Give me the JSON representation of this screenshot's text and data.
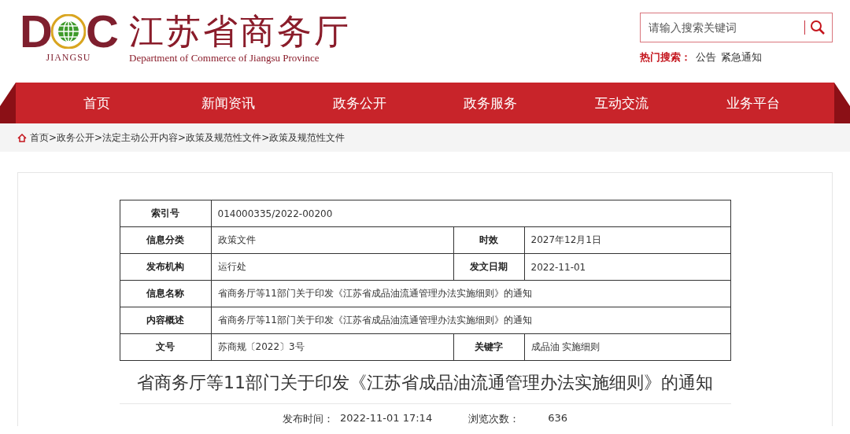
{
  "logo": {
    "letters": [
      "D",
      "C"
    ],
    "region": "JIANGSU",
    "name_cn": "江苏省商务厅",
    "name_en": "Department of Commerce of Jiangsu Province"
  },
  "search": {
    "placeholder": "请输入搜索关键词"
  },
  "hot_search": {
    "label": "热门搜索：",
    "items": [
      "公告",
      "紧急通知"
    ]
  },
  "nav": [
    "首页",
    "新闻资讯",
    "政务公开",
    "政务服务",
    "互动交流",
    "业务平台"
  ],
  "breadcrumb": "首页>政务公开>法定主动公开内容>政策及规范性文件>政策及规范性文件",
  "info_table": {
    "rows": [
      [
        {
          "label": "索引号",
          "value": "014000335/2022-00200"
        }
      ],
      [
        {
          "label": "信息分类",
          "value": "政策文件"
        },
        {
          "label": "时效",
          "value": "2027年12月1日"
        }
      ],
      [
        {
          "label": "发布机构",
          "value": "运行处"
        },
        {
          "label": "发文日期",
          "value": "2022-11-01"
        }
      ],
      [
        {
          "label": "信息名称",
          "value": "省商务厅等11部门关于印发《江苏省成品油流通管理办法实施细则》的通知"
        }
      ],
      [
        {
          "label": "内容概述",
          "value": "省商务厅等11部门关于印发《江苏省成品油流通管理办法实施细则》的通知"
        }
      ],
      [
        {
          "label": "文号",
          "value": "苏商规〔2022〕3号"
        },
        {
          "label": "关键字",
          "value": "成品油 实施细则"
        }
      ]
    ]
  },
  "article": {
    "title": "省商务厅等11部门关于印发《江苏省成品油流通管理办法实施细则》的通知",
    "published_label": "发布时间：",
    "published": "2022-11-01 17:14",
    "views_label": "浏览次数：",
    "views": "636"
  }
}
